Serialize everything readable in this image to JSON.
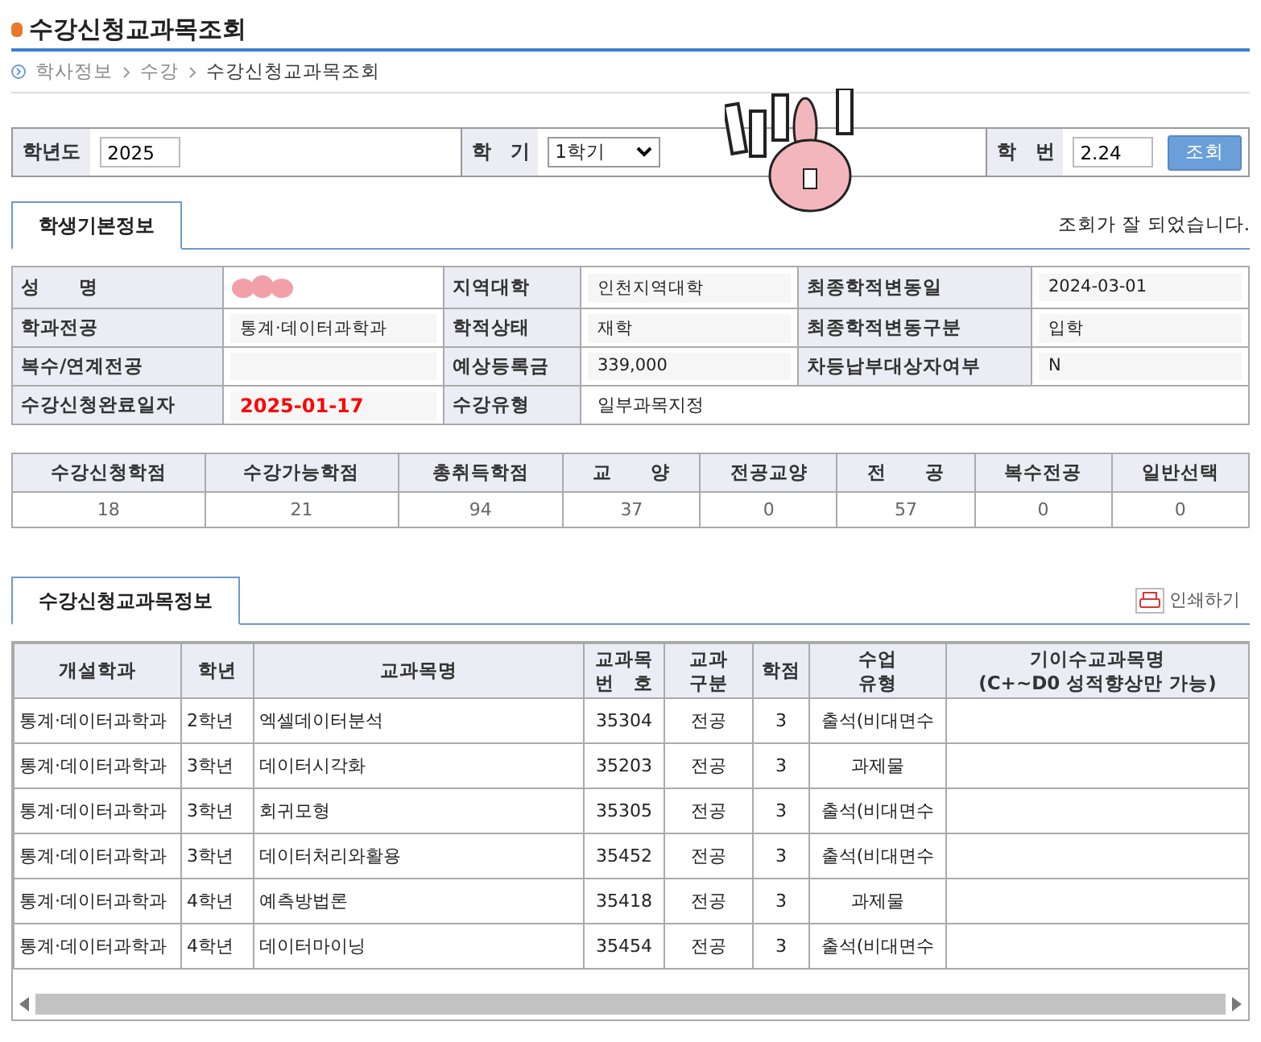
{
  "page_title": "수강신청교과목조회",
  "breadcrumb": [
    "학사정보",
    "수강",
    "수강신청교과목조회"
  ],
  "search": {
    "year_label": "학년도",
    "year_value": "2025",
    "term_label": "학　기",
    "term_value": "1학기",
    "id_label": "학　번",
    "id_value": "2.24",
    "button": "조회"
  },
  "tabs": [
    {
      "label": "학생기본정보",
      "selected": true
    }
  ],
  "message": "조회가 잘 되었습니다.",
  "info": [
    [
      {
        "label": "성　　명",
        "masked": true
      },
      {
        "label": "지역대학",
        "value": "인천지역대학"
      },
      {
        "label": "최종학적변동일",
        "value": "2024-03-01"
      }
    ],
    [
      {
        "label": "학과전공",
        "value": "통계·데이터과학과"
      },
      {
        "label": "학적상태",
        "value": "재학"
      },
      {
        "label": "최종학적변동구분",
        "value": "입학"
      }
    ],
    [
      {
        "label": "복수/연계전공"
      },
      {
        "label": "예상등록금",
        "value": "339,000"
      },
      {
        "label": "차등납부대상자여부",
        "value": "N"
      }
    ],
    [
      {
        "label": "수강신청완료일자",
        "value": "2025-01-17",
        "highlight": true
      },
      {
        "label": "수강유형",
        "value": "일부과목지정",
        "wide": true
      }
    ]
  ],
  "credits": {
    "columns": [
      "수강신청학점",
      "수강가능학점",
      "총취득학점",
      "교　　양",
      "전공교양",
      "전　　공",
      "복수전공",
      "일반선택"
    ],
    "values": [
      "18",
      "21",
      "94",
      "37",
      "0",
      "57",
      "0",
      "0"
    ]
  },
  "course_tabs": [
    {
      "label": "수강신청교과목정보",
      "selected": true
    }
  ],
  "print_button": "인쇄하기",
  "courses": {
    "columns": [
      "개설학과",
      "학년",
      "교과목명",
      "교과목\n번　호",
      "교과\n구분",
      "학점",
      "수업\n유형",
      "기이수교과목명\n(C+~D0 성적향상만 가능)"
    ],
    "rows": [
      [
        "통계·데이터과학과",
        "2학년",
        "엑셀데이터분석",
        "35304",
        "전공",
        "3",
        "출석(비대면수",
        ""
      ],
      [
        "통계·데이터과학과",
        "3학년",
        "데이터시각화",
        "35203",
        "전공",
        "3",
        "과제물",
        ""
      ],
      [
        "통계·데이터과학과",
        "3학년",
        "회귀모형",
        "35305",
        "전공",
        "3",
        "출석(비대면수",
        ""
      ],
      [
        "통계·데이터과학과",
        "3학년",
        "데이터처리와활용",
        "35452",
        "전공",
        "3",
        "출석(비대면수",
        ""
      ],
      [
        "통계·데이터과학과",
        "4학년",
        "예측방법론",
        "35418",
        "전공",
        "3",
        "과제물",
        ""
      ],
      [
        "통계·데이터과학과",
        "4학년",
        "데이터마이닝",
        "35454",
        "전공",
        "3",
        "출석(비대면수",
        ""
      ]
    ]
  }
}
